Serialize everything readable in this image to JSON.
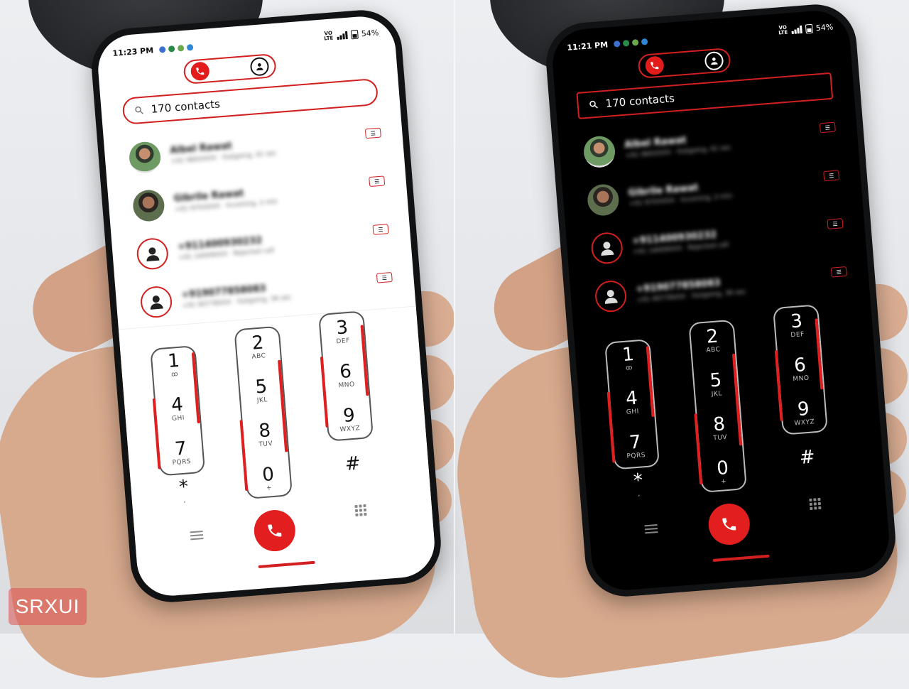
{
  "watermark": "SRXUI",
  "phones": {
    "light": {
      "time": "11:23 PM",
      "battery": "54%",
      "network": "VO LTE"
    },
    "dark": {
      "time": "11:21 PM",
      "battery": "54%",
      "network": "VO LTE"
    }
  },
  "search": {
    "text": "170 contacts"
  },
  "contacts": [
    {
      "name": "Albel Rawat",
      "detail": "+91 98XXXXX  ·  Outgoing, 41 sec"
    },
    {
      "name": "Gibrile Rawat",
      "detail": "+91 97XXXXX  ·  Incoming, 2 min"
    },
    {
      "name": "+911400930232",
      "detail": "+91 14009XXX  ·  Rejected call"
    },
    {
      "name": "+919077858083",
      "detail": "+91 90778XXX  ·  Outgoing, 36 sec"
    }
  ],
  "keys": [
    {
      "digit": "1",
      "letters": "ꝏ"
    },
    {
      "digit": "2",
      "letters": "ABC"
    },
    {
      "digit": "3",
      "letters": "DEF"
    },
    {
      "digit": "4",
      "letters": "GHI"
    },
    {
      "digit": "5",
      "letters": "JKL"
    },
    {
      "digit": "6",
      "letters": "MNO"
    },
    {
      "digit": "7",
      "letters": "PQRS"
    },
    {
      "digit": "8",
      "letters": "TUV"
    },
    {
      "digit": "9",
      "letters": "WXYZ"
    },
    {
      "digit": "0",
      "letters": "+"
    },
    {
      "digit": "*",
      "letters": ","
    },
    {
      "digit": "#",
      "letters": ""
    }
  ],
  "colors": {
    "accent": "#e31e1e",
    "light_bg": "#ffffff",
    "dark_bg": "#000000"
  }
}
